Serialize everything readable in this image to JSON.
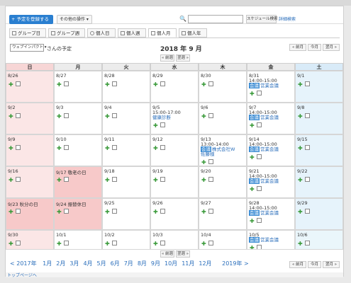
{
  "toolbar": {
    "add_label": "+ 予定を登録する",
    "other_label": "その他の操作 ▾",
    "search_placeholder": "",
    "search_button": "スケジュール検索",
    "advanced_link": "詳細検索"
  },
  "tabs": [
    {
      "label": "グループ日"
    },
    {
      "label": "グループ週"
    },
    {
      "label": "個人日"
    },
    {
      "label": "個人週"
    },
    {
      "label": "個人月"
    },
    {
      "label": "個人年"
    }
  ],
  "header": {
    "select_value": "ウェブインパクト ▾",
    "user_label": "さんの予定",
    "month_title": "2018 年 9 月",
    "prev_month": "« 前月",
    "today": "今月",
    "next_month": "翌月 »",
    "prev_week": "« 前週",
    "next_week": "翌週 »"
  },
  "dow": [
    "日",
    "月",
    "火",
    "水",
    "木",
    "金",
    "土"
  ],
  "weeks": [
    [
      {
        "d": "8/26"
      },
      {
        "d": "8/27"
      },
      {
        "d": "8/28"
      },
      {
        "d": "8/29"
      },
      {
        "d": "8/30"
      },
      {
        "d": "8/31",
        "ev": {
          "time": "14:00-15:00",
          "tag": "会議",
          "title": "営業会議"
        }
      },
      {
        "d": "9/1"
      }
    ],
    [
      {
        "d": "9/2"
      },
      {
        "d": "9/3"
      },
      {
        "d": "9/4"
      },
      {
        "d": "9/5",
        "ev": {
          "time": "15:00-17:00",
          "tag": "",
          "title": "健康診断"
        }
      },
      {
        "d": "9/6"
      },
      {
        "d": "9/7",
        "ev": {
          "time": "14:00-15:00",
          "tag": "会議",
          "title": "営業会議"
        }
      },
      {
        "d": "9/8"
      }
    ],
    [
      {
        "d": "9/9"
      },
      {
        "d": "9/10"
      },
      {
        "d": "9/11"
      },
      {
        "d": "9/12"
      },
      {
        "d": "9/13",
        "ev": {
          "time": "13:00-14:00",
          "tag": "会議",
          "title": "株式会社W",
          "title2": "佐藤様"
        }
      },
      {
        "d": "9/14",
        "ev": {
          "time": "14:00-15:00",
          "tag": "会議",
          "title": "営業会議"
        }
      },
      {
        "d": "9/15"
      }
    ],
    [
      {
        "d": "9/16"
      },
      {
        "d": "9/17 敬老の日"
      },
      {
        "d": "9/18"
      },
      {
        "d": "9/19"
      },
      {
        "d": "9/20"
      },
      {
        "d": "9/21",
        "ev": {
          "time": "14:00-15:00",
          "tag": "会議",
          "title": "営業会議"
        }
      },
      {
        "d": "9/22"
      }
    ],
    [
      {
        "d": "9/23 秋分の日"
      },
      {
        "d": "9/24 振替休日"
      },
      {
        "d": "9/25"
      },
      {
        "d": "9/26"
      },
      {
        "d": "9/27"
      },
      {
        "d": "9/28",
        "ev": {
          "time": "14:00-15:00",
          "tag": "会議",
          "title": "営業会議"
        }
      },
      {
        "d": "9/29"
      }
    ],
    [
      {
        "d": "9/30"
      },
      {
        "d": "10/1"
      },
      {
        "d": "10/2"
      },
      {
        "d": "10/3"
      },
      {
        "d": "10/4"
      },
      {
        "d": "10/5",
        "ev": {
          "time": "",
          "tag": "会議",
          "title": "営業会議"
        }
      },
      {
        "d": "10/6"
      }
    ]
  ],
  "yearbar": {
    "prev_year": "< 2017年",
    "months": [
      "1月",
      "2月",
      "3月",
      "4月",
      "5月",
      "6月",
      "7月",
      "8月",
      "9月",
      "10月",
      "11月",
      "12月"
    ],
    "next_year": "2019年 >"
  },
  "footer": {
    "label": "トップページへ"
  }
}
